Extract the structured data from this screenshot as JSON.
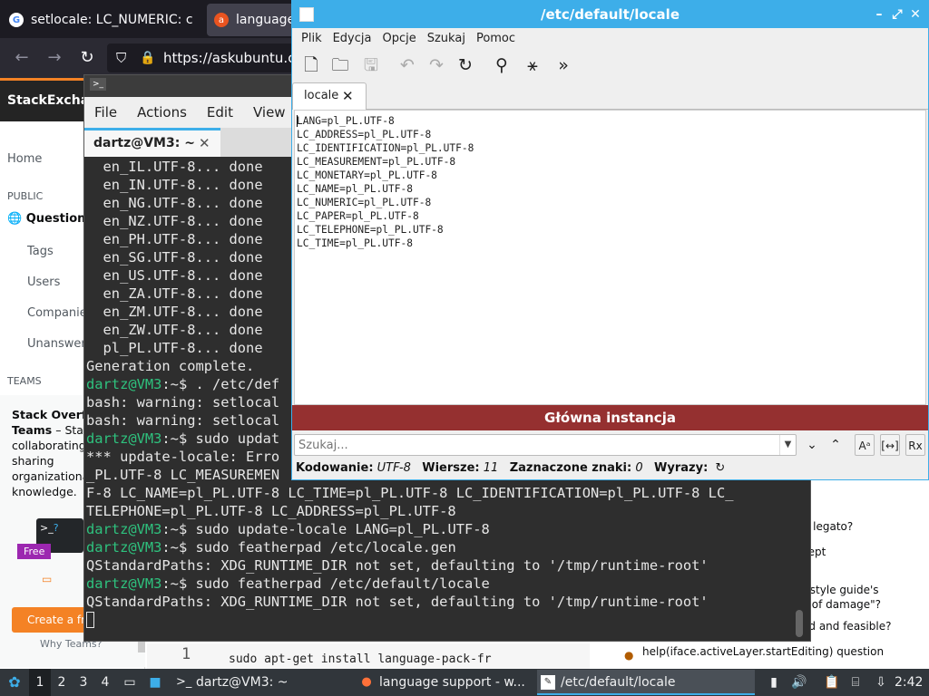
{
  "colors": {
    "accent": "#3daee9",
    "prompt_green": "#2ec27e",
    "banner_red": "#953030",
    "stackoverflow_orange": "#f48225"
  },
  "browser": {
    "tabs": [
      {
        "title": "setlocale: LC_NUMERIC: c",
        "icon": "google-icon"
      },
      {
        "title": "language",
        "icon": "askubuntu-icon"
      }
    ],
    "url": "https://askubuntu.co",
    "page": {
      "logo": "StackExcha",
      "sidebar": {
        "home": "Home",
        "public_heading": "PUBLIC",
        "questions": "Questions",
        "tags": "Tags",
        "users": "Users",
        "companies": "Companies",
        "unanswered": "Unanswere",
        "teams_heading": "TEAMS"
      },
      "teams_box": {
        "title": "Stack Overflo",
        "line2_bold": "Teams",
        "line2_rest": " – Star",
        "line3": "collaborating",
        "line4": "sharing",
        "line5": "organizational",
        "line6": "knowledge.",
        "free_badge": "Free",
        "create_button": "Create a free",
        "why_link": "Why Teams?"
      },
      "right_snippets": [
        "ble legato?",
        "cept",
        "he style guide's",
        "ts of damage\"?",
        "ed and feasible?",
        "help(iface.activeLayer.startEditing) question"
      ],
      "code_line_number": "1",
      "code_line": "sudo apt-get install language-pack-fr"
    }
  },
  "terminal": {
    "menu": [
      "File",
      "Actions",
      "Edit",
      "View"
    ],
    "tab_title": "dartz@VM3: ~",
    "lines": [
      {
        "type": "out",
        "text": "  en_IL.UTF-8... done"
      },
      {
        "type": "out",
        "text": "  en_IN.UTF-8... done"
      },
      {
        "type": "out",
        "text": "  en_NG.UTF-8... done"
      },
      {
        "type": "out",
        "text": "  en_NZ.UTF-8... done"
      },
      {
        "type": "out",
        "text": "  en_PH.UTF-8... done"
      },
      {
        "type": "out",
        "text": "  en_SG.UTF-8... done"
      },
      {
        "type": "out",
        "text": "  en_US.UTF-8... done"
      },
      {
        "type": "out",
        "text": "  en_ZA.UTF-8... done"
      },
      {
        "type": "out",
        "text": "  en_ZM.UTF-8... done"
      },
      {
        "type": "out",
        "text": "  en_ZW.UTF-8... done"
      },
      {
        "type": "out",
        "text": "  pl_PL.UTF-8... done"
      },
      {
        "type": "out",
        "text": "Generation complete."
      },
      {
        "type": "cmd",
        "prompt": "dartz@VM3",
        "rest": ":~$ . /etc/def"
      },
      {
        "type": "out",
        "text": "bash: warning: setlocal"
      },
      {
        "type": "out",
        "text": "bash: warning: setlocal"
      },
      {
        "type": "cmd",
        "prompt": "dartz@VM3",
        "rest": ":~$ sudo updat"
      },
      {
        "type": "out",
        "text": "*** update-locale: Erro"
      },
      {
        "type": "out",
        "text": "_PL.UTF-8 LC_MEASUREMEN"
      },
      {
        "type": "out",
        "text": "F-8 LC_NAME=pl_PL.UTF-8 LC_TIME=pl_PL.UTF-8 LC_IDENTIFICATION=pl_PL.UTF-8 LC_"
      },
      {
        "type": "out",
        "text": "TELEPHONE=pl_PL.UTF-8 LC_ADDRESS=pl_PL.UTF-8"
      },
      {
        "type": "cmd",
        "prompt": "dartz@VM3",
        "rest": ":~$ sudo update-locale LANG=pl_PL.UTF-8"
      },
      {
        "type": "cmd",
        "prompt": "dartz@VM3",
        "rest": ":~$ sudo featherpad /etc/locale.gen"
      },
      {
        "type": "out",
        "text": "QStandardPaths: XDG_RUNTIME_DIR not set, defaulting to '/tmp/runtime-root'"
      },
      {
        "type": "cmd",
        "prompt": "dartz@VM3",
        "rest": ":~$ sudo featherpad /etc/default/locale"
      },
      {
        "type": "out",
        "text": "QStandardPaths: XDG_RUNTIME_DIR not set, defaulting to '/tmp/runtime-root'"
      }
    ]
  },
  "editor": {
    "window_title": "/etc/default/locale",
    "menu": [
      "Plik",
      "Edycja",
      "Opcje",
      "Szukaj",
      "Pomoc"
    ],
    "tab_title": "locale",
    "content": "LANG=pl_PL.UTF-8\nLC_ADDRESS=pl_PL.UTF-8\nLC_IDENTIFICATION=pl_PL.UTF-8\nLC_MEASUREMENT=pl_PL.UTF-8\nLC_MONETARY=pl_PL.UTF-8\nLC_NAME=pl_PL.UTF-8\nLC_NUMERIC=pl_PL.UTF-8\nLC_PAPER=pl_PL.UTF-8\nLC_TELEPHONE=pl_PL.UTF-8\nLC_TIME=pl_PL.UTF-8",
    "banner": "Główna instancja",
    "search_placeholder": "Szukaj...",
    "status": {
      "encoding_label": "Kodowanie:",
      "encoding_value": "UTF-8",
      "lines_label": "Wiersze:",
      "lines_value": "11",
      "selected_label": "Zaznaczone znaki:",
      "selected_value": "0",
      "words_label": "Wyrazy:"
    }
  },
  "taskbar": {
    "workspaces": [
      "1",
      "2",
      "3",
      "4"
    ],
    "current_workspace": "1",
    "tasks": [
      {
        "label": "dartz@VM3: ~",
        "icon": "terminal-icon"
      },
      {
        "label": "language support - w...",
        "icon": "firefox-icon"
      },
      {
        "label": "/etc/default/locale",
        "icon": "featherpad-icon"
      }
    ],
    "clock": "2:42"
  }
}
